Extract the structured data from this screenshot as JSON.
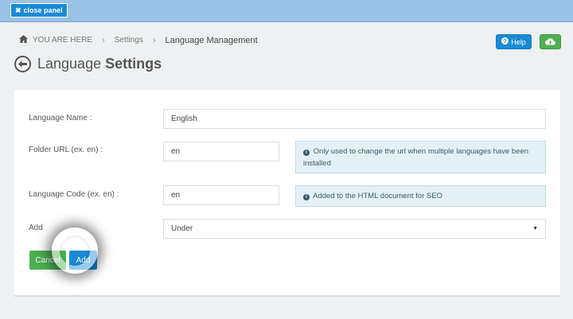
{
  "topbar": {
    "close_panel_label": "close panel"
  },
  "breadcrumb": {
    "home_label": "YOU ARE HERE",
    "items": [
      "Settings",
      "Language Management"
    ]
  },
  "toolbar": {
    "help_label": "Help"
  },
  "page": {
    "title_regular": "Language",
    "title_bold": "Settings"
  },
  "form": {
    "language_name": {
      "label": "Language Name :",
      "value": "English"
    },
    "folder_url": {
      "label": "Folder URL (ex. en) :",
      "value": "en",
      "info": "Only used to change the url when multiple languages have been installed"
    },
    "language_code": {
      "label": "Language Code (ex. en) :",
      "value": "en",
      "info": "Added to the HTML document for SEO"
    },
    "add": {
      "label": "Add",
      "selected": "Under"
    },
    "cancel_label": "Cancel",
    "add_label": "Add"
  },
  "colors": {
    "primary": "#1a8ad4",
    "success": "#4caf50",
    "topbar": "#9cc3e6",
    "info_bg": "#e3f1f7"
  },
  "icons": [
    "times-icon",
    "home-icon",
    "question-icon",
    "cloud-upload-icon",
    "back-arrow-icon",
    "info-icon",
    "caret-down-icon"
  ]
}
